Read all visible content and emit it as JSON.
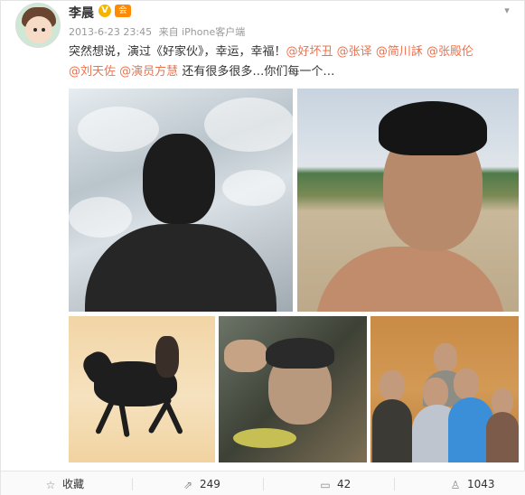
{
  "user": {
    "name": "李晨",
    "verify_badge": "V",
    "vip_badge": "会",
    "avatar_icon": "avatar-cartoon"
  },
  "meta": {
    "time": "2013-6-23 23:45",
    "source": "来自 iPhone客户端"
  },
  "post": {
    "text_start": "突然想说，演过《好家伙》，幸运，幸福！",
    "mentions": [
      "@好坏丑",
      "@张译",
      "@简川訸",
      "@张殿伦",
      "@刘天佐",
      "@演员方慧"
    ],
    "text_end": "还有很多很多…你们每一个…"
  },
  "photos": [
    {
      "icon": "photo-silhouette-clouds"
    },
    {
      "icon": "photo-selfie-desert"
    },
    {
      "icon": "photo-horse-rider"
    },
    {
      "icon": "photo-makeup-smile"
    },
    {
      "icon": "photo-group-dinner"
    }
  ],
  "actions": {
    "favorite_label": "收藏",
    "repost_count": "249",
    "comment_count": "42",
    "like_count": "1043"
  },
  "colors": {
    "accent": "#eb7350",
    "verify": "#f5b400",
    "vip": "#ff8a00"
  }
}
